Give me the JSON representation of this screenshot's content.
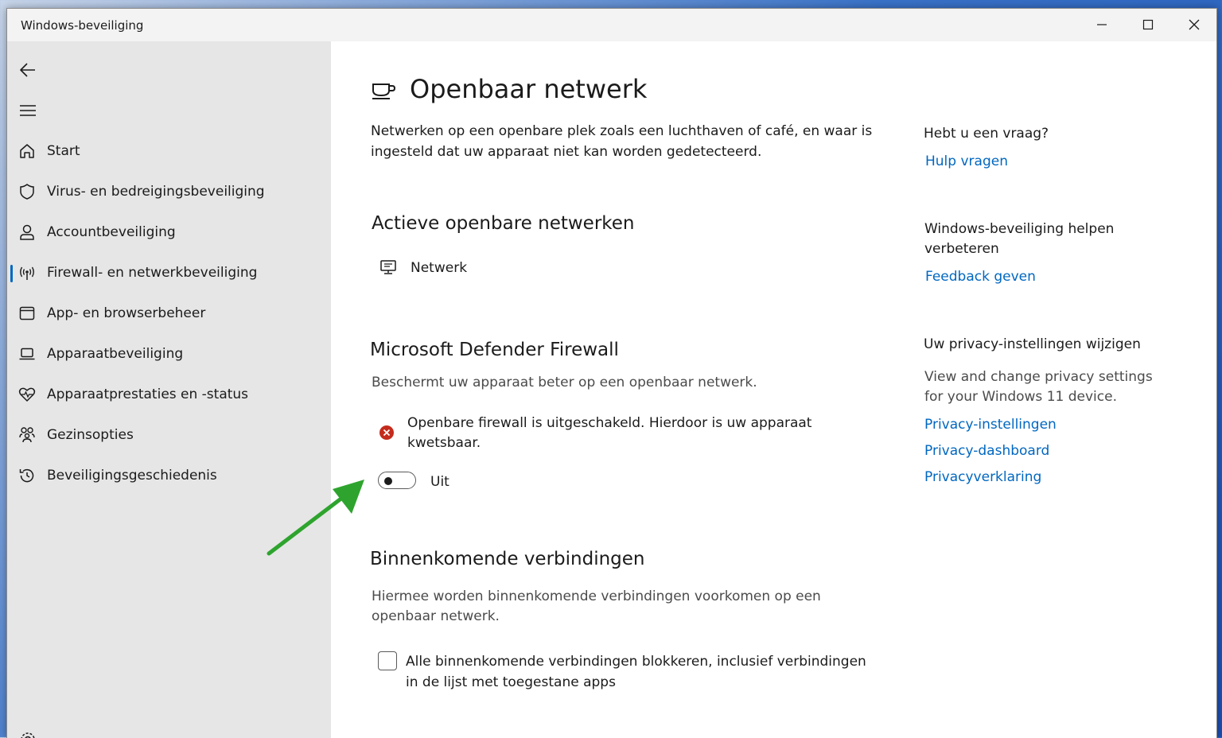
{
  "window": {
    "title": "Windows-beveiliging"
  },
  "sidebar": {
    "items": [
      {
        "label": "Start",
        "icon": "home-icon"
      },
      {
        "label": "Virus- en bedreigingsbeveiliging",
        "icon": "shield-icon"
      },
      {
        "label": "Accountbeveiliging",
        "icon": "person-icon"
      },
      {
        "label": "Firewall- en netwerkbeveiliging",
        "icon": "wireless-icon",
        "active": true
      },
      {
        "label": "App- en browserbeheer",
        "icon": "app-window-icon"
      },
      {
        "label": "Apparaatbeveiliging",
        "icon": "laptop-icon"
      },
      {
        "label": "Apparaatprestaties en -status",
        "icon": "heart-pulse-icon"
      },
      {
        "label": "Gezinsopties",
        "icon": "family-icon"
      },
      {
        "label": "Beveiligingsgeschiedenis",
        "icon": "history-icon"
      }
    ]
  },
  "main": {
    "title": "Openbaar netwerk",
    "title_icon": "coffee-cup-icon",
    "description": [
      "Netwerken op een openbare plek zoals een luchthaven of café, en waar is",
      "ingesteld dat uw apparaat niet kan worden gedetecteerd."
    ],
    "active_networks": {
      "heading": "Actieve openbare netwerken",
      "network_name": "Netwerk",
      "network_icon": "monitor-network-icon"
    },
    "firewall": {
      "heading": "Microsoft Defender Firewall",
      "description": "Beschermt uw apparaat beter op een openbaar netwerk.",
      "warning": [
        "Openbare firewall is uitgeschakeld. Hierdoor is uw apparaat",
        "kwetsbaar."
      ],
      "warning_icon": "error-x-icon",
      "toggle_state": false,
      "toggle_label": "Uit"
    },
    "incoming": {
      "heading": "Binnenkomende verbindingen",
      "description": [
        "Hiermee worden binnenkomende verbindingen voorkomen op een",
        "openbaar netwerk."
      ],
      "checkbox_checked": false,
      "checkbox_label": [
        "Alle binnenkomende verbindingen blokkeren, inclusief verbindingen",
        "in de lijst met toegestane apps"
      ]
    }
  },
  "right_panel": {
    "question_heading": "Hebt u een vraag?",
    "help_link": "Hulp vragen",
    "improve_heading": [
      "Windows-beveiliging helpen",
      "verbeteren"
    ],
    "feedback_link": "Feedback geven",
    "privacy_heading": "Uw privacy-instellingen wijzigen",
    "privacy_text": [
      "View and change privacy settings",
      "for your Windows 11 device."
    ],
    "privacy_links": [
      "Privacy-instellingen",
      "Privacy-dashboard",
      "Privacyverklaring"
    ]
  },
  "colors": {
    "accent": "#0067c0",
    "sidebar_bg": "#e6e6e6",
    "error": "#c42b1c",
    "annotation_arrow": "#2ea42e"
  }
}
